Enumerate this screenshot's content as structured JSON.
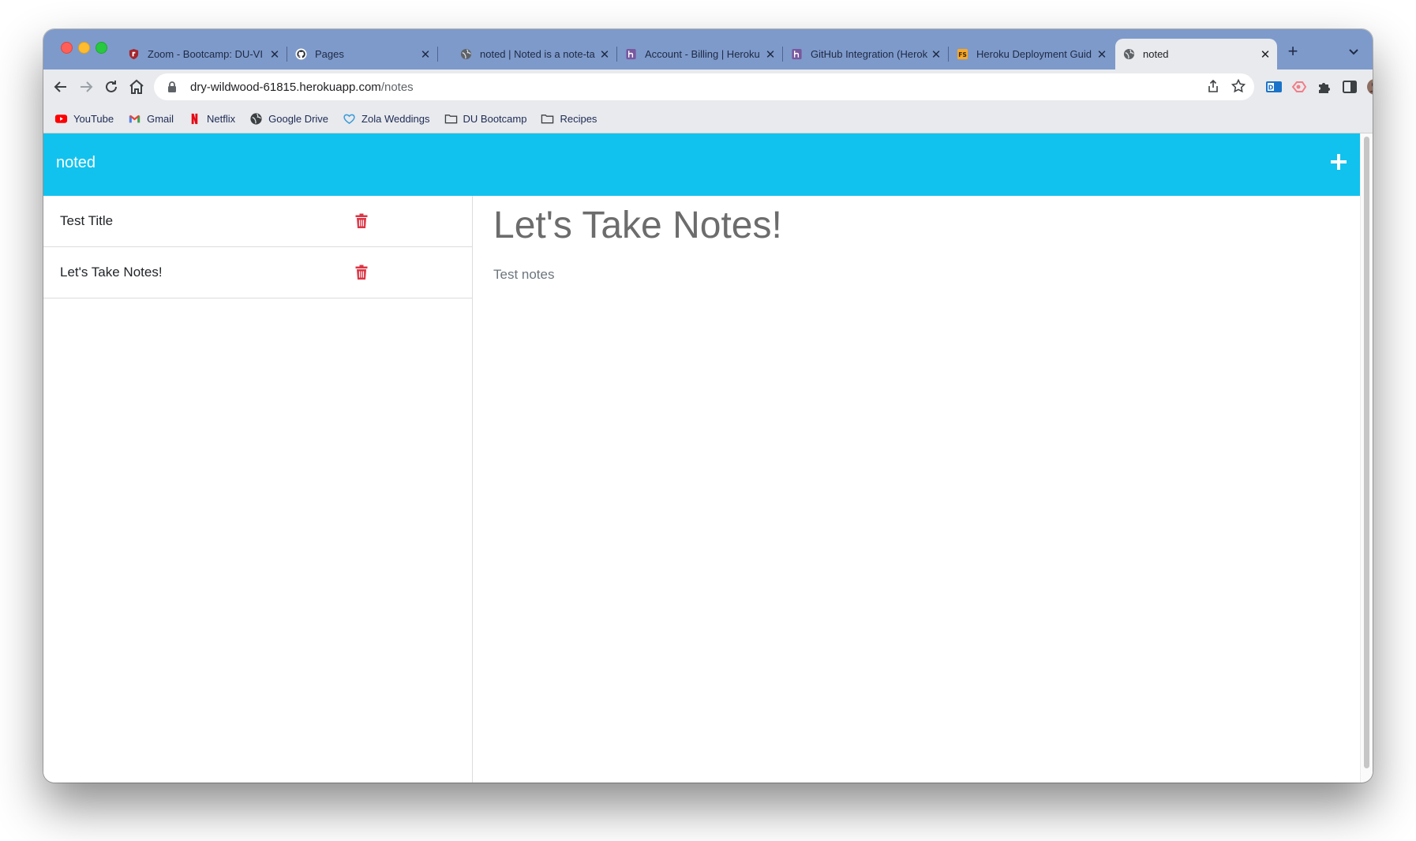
{
  "browser": {
    "tabs": [
      {
        "title": "Zoom - Bootcamp: DU-VI",
        "icon": "zoom-shield-icon",
        "active": false
      },
      {
        "title": "Pages",
        "icon": "github-icon",
        "active": false
      },
      {
        "title": "noted | Noted is a note-ta",
        "icon": "globe-icon",
        "active": false
      },
      {
        "title": "Account - Billing | Heroku",
        "icon": "heroku-icon",
        "active": false
      },
      {
        "title": "GitHub Integration (Herok",
        "icon": "heroku-icon",
        "active": false
      },
      {
        "title": "Heroku Deployment Guid",
        "icon": "fs-icon",
        "active": false
      },
      {
        "title": "noted",
        "icon": "globe-icon",
        "active": true
      }
    ],
    "url_host": "dry-wildwood-61815.herokuapp.com",
    "url_path": "/notes",
    "bookmarks": [
      {
        "label": "YouTube",
        "icon": "youtube-icon"
      },
      {
        "label": "Gmail",
        "icon": "gmail-icon"
      },
      {
        "label": "Netflix",
        "icon": "netflix-icon"
      },
      {
        "label": "Google Drive",
        "icon": "globe-icon"
      },
      {
        "label": "Zola Weddings",
        "icon": "heart-icon"
      },
      {
        "label": "DU Bootcamp",
        "icon": "folder-icon"
      },
      {
        "label": "Recipes",
        "icon": "folder-icon"
      }
    ]
  },
  "app": {
    "brand": "noted",
    "notes": [
      {
        "title": "Test Title"
      },
      {
        "title": "Let's Take Notes!"
      }
    ],
    "active_note": {
      "title": "Let's Take Notes!",
      "body": "Test notes"
    },
    "colors": {
      "navbar": "#11c2ee",
      "trash": "#dc3545",
      "tabstrip": "#7e9acb"
    }
  }
}
